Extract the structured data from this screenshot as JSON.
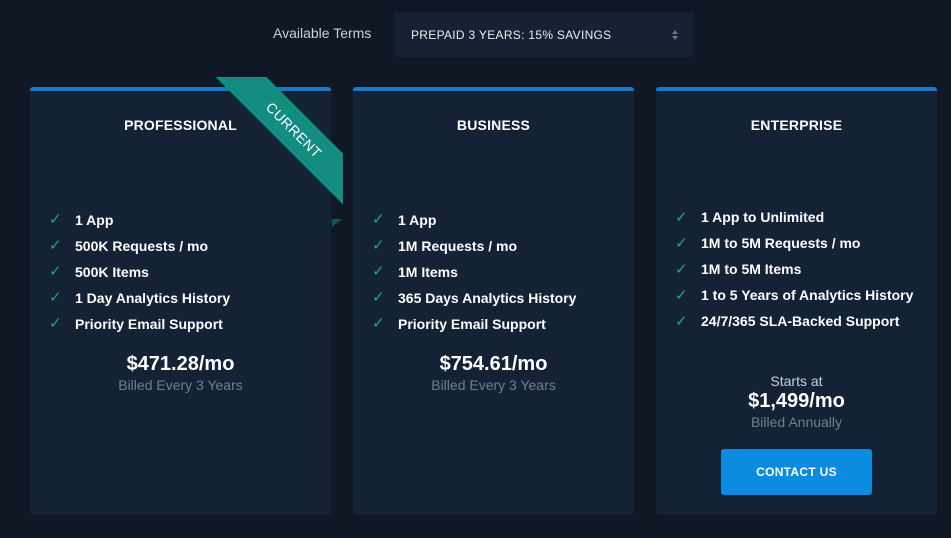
{
  "terms": {
    "label": "Available Terms",
    "selected": "PREPAID 3 YEARS: 15% SAVINGS"
  },
  "plans": [
    {
      "name": "PROFESSIONAL",
      "ribbon": "CURRENT",
      "features": [
        "1 App",
        "500K Requests / mo",
        "500K Items",
        "1 Day Analytics History",
        "Priority Email Support"
      ],
      "price": "$471.28/mo",
      "billing": "Billed Every 3 Years"
    },
    {
      "name": "BUSINESS",
      "features": [
        "1 App",
        "1M Requests / mo",
        "1M Items",
        "365 Days Analytics History",
        "Priority Email Support"
      ],
      "price": "$754.61/mo",
      "billing": "Billed Every 3 Years"
    },
    {
      "name": "ENTERPRISE",
      "features": [
        "1 App to Unlimited",
        "1M to 5M Requests / mo",
        "1M to 5M Items",
        "1 to 5 Years of Analytics History",
        "24/7/365 SLA-Backed Support"
      ],
      "price_prefix": "Starts at",
      "price": "$1,499/mo",
      "billing": "Billed Annually",
      "cta": "CONTACT US"
    }
  ],
  "colors": {
    "background": "#0f1824",
    "card": "#142236",
    "accent_border": "#1c78c4",
    "check": "#18a88a",
    "ribbon": "#128d80",
    "button": "#0b8ce0"
  },
  "icons": {
    "feature": "check-icon",
    "select": "up-down-arrows-icon"
  }
}
